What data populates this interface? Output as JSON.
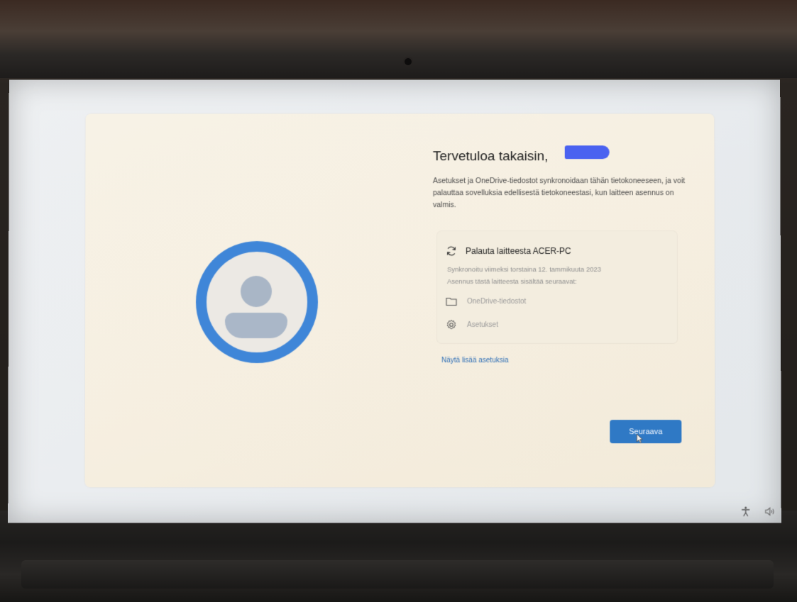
{
  "oobe": {
    "title": "Tervetuloa takaisin,",
    "description": "Asetukset ja OneDrive-tiedostot synkronoidaan tähän tietokoneeseen, ja voit palauttaa sovelluksia edellisestä tietokoneestasi, kun laitteen asennus on valmis.",
    "restore": {
      "title": "Palauta laitteesta ACER-PC",
      "last_sync": "Synkronoitu viimeksi torstaina 12. tammikuuta 2023",
      "includes": "Asennus tästä laitteesta sisältää seuraavat:",
      "items": [
        {
          "label": "OneDrive-tiedostot",
          "icon": "folder-icon"
        },
        {
          "label": "Asetukset",
          "icon": "gear-icon"
        }
      ]
    },
    "more_settings_link": "Näytä lisää asetuksia",
    "next_button": "Seuraava"
  },
  "tray": {
    "icons": [
      "accessibility-icon",
      "volume-icon"
    ]
  },
  "colors": {
    "accent": "#2f79c5",
    "ring": "#3f86d8",
    "card": "#f6efe1"
  }
}
